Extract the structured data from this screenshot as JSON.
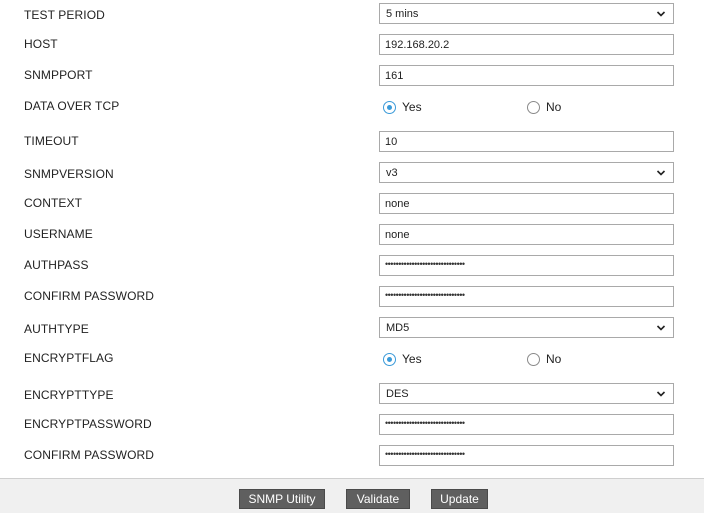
{
  "form": {
    "test_period": {
      "label": "TEST PERIOD",
      "value": "5 mins"
    },
    "host": {
      "label": "HOST",
      "value": "192.168.20.2"
    },
    "snmpport": {
      "label": "SNMPPORT",
      "value": "161"
    },
    "data_over_tcp": {
      "label": "DATA OVER TCP",
      "yes": "Yes",
      "no": "No",
      "selected": "Yes"
    },
    "timeout": {
      "label": "TIMEOUT",
      "value": "10"
    },
    "snmpversion": {
      "label": "SNMPVERSION",
      "value": "v3"
    },
    "context": {
      "label": "CONTEXT",
      "value": "none"
    },
    "username": {
      "label": "USERNAME",
      "value": "none"
    },
    "authpass": {
      "label": "AUTHPASS",
      "value": "••••••••••••••••••••••••••••••"
    },
    "confirm_password_1": {
      "label": "CONFIRM PASSWORD",
      "value": "••••••••••••••••••••••••••••••"
    },
    "authtype": {
      "label": "AUTHTYPE",
      "value": "MD5"
    },
    "encryptflag": {
      "label": "ENCRYPTFLAG",
      "yes": "Yes",
      "no": "No",
      "selected": "Yes"
    },
    "encrypttype": {
      "label": "ENCRYPTTYPE",
      "value": "DES"
    },
    "encryptpassword": {
      "label": "ENCRYPTPASSWORD",
      "value": "••••••••••••••••••••••••••••••"
    },
    "confirm_password_2": {
      "label": "CONFIRM PASSWORD",
      "value": "••••••••••••••••••••••••••••••"
    }
  },
  "footer": {
    "snmp_utility": "SNMP Utility",
    "validate": "Validate",
    "update": "Update"
  },
  "colors": {
    "accent": "#3a9ad9",
    "button_bg": "#5f5f5f",
    "footer_bg": "#f0f0f0"
  }
}
